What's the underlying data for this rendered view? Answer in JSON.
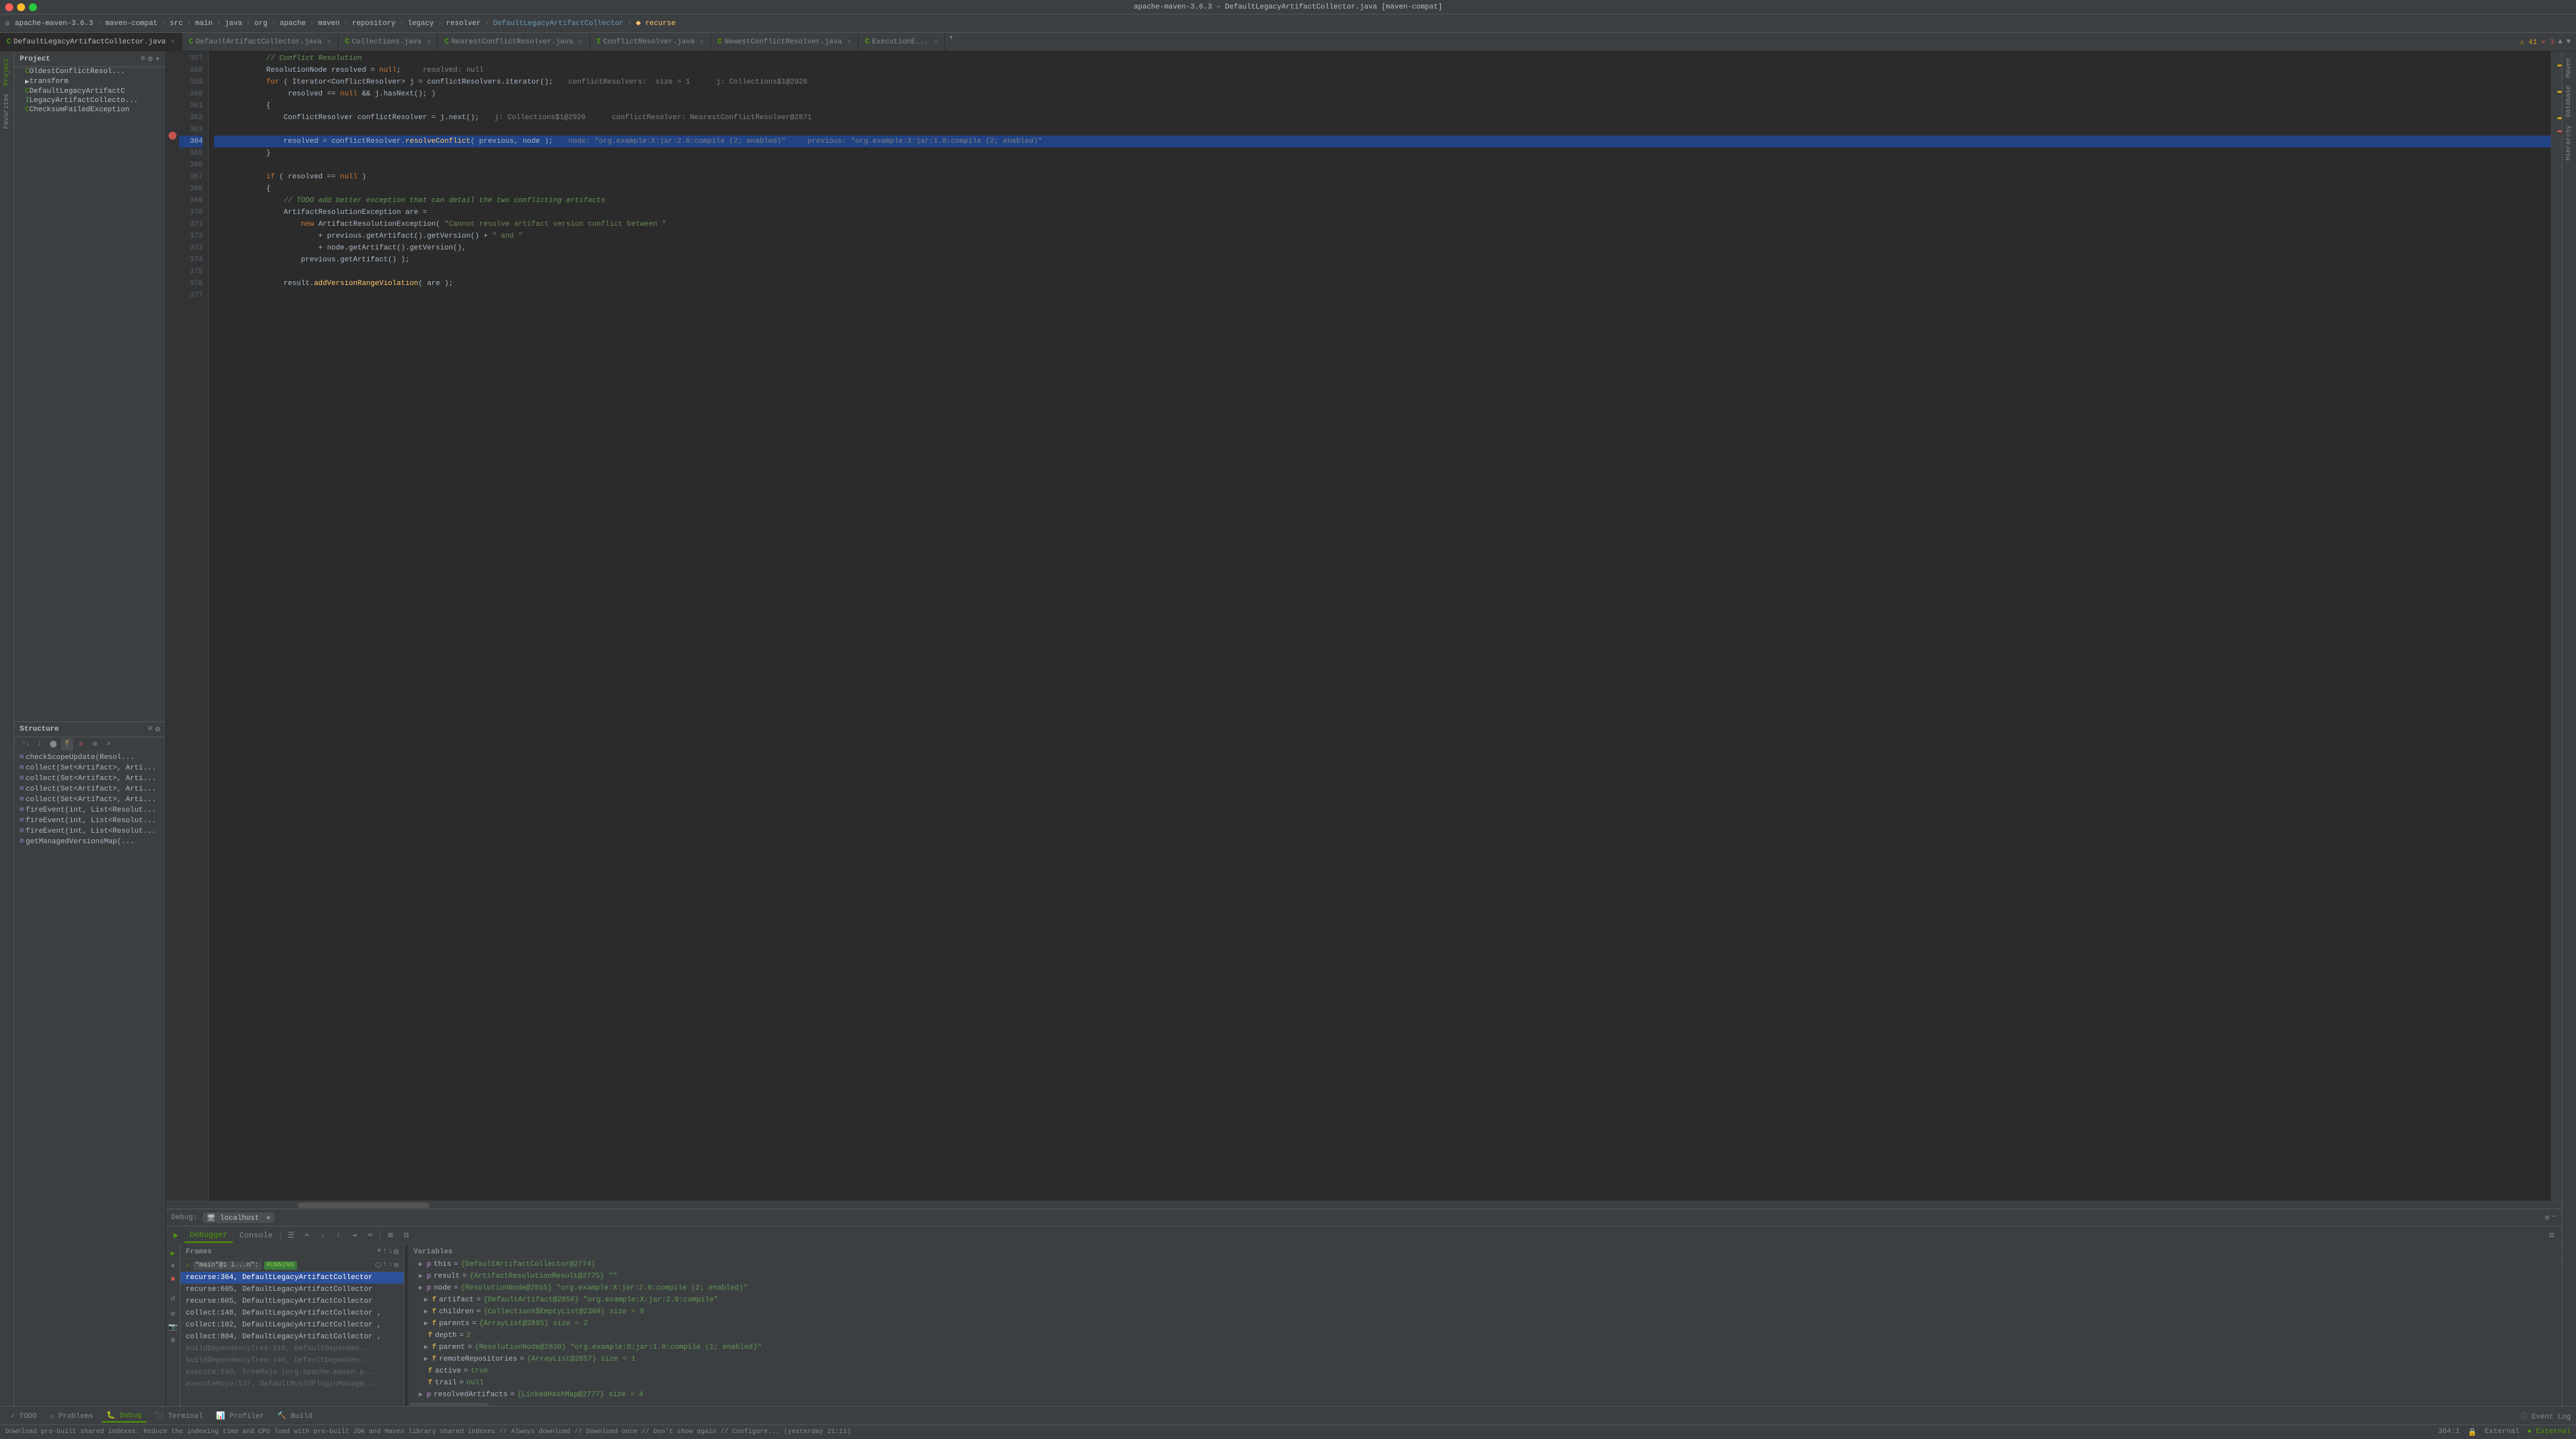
{
  "window": {
    "title": "apache-maven-3.6.3 – DefaultLegacyArtifactCollector.java [maven-compat]",
    "traffic_lights": [
      "red",
      "yellow",
      "green"
    ]
  },
  "breadcrumb": {
    "items": [
      "apache-maven-3.6.3",
      "maven-compat",
      "src",
      "main",
      "java",
      "org",
      "apache",
      "maven",
      "repository",
      "legacy",
      "resolver",
      "DefaultLegacyArtifactCollector",
      "recurse"
    ]
  },
  "tabs": [
    {
      "label": "DefaultLegacyArtifactCollector.java",
      "icon": "C",
      "active": true
    },
    {
      "label": "DefaultArtifactCollector.java",
      "icon": "C",
      "active": false
    },
    {
      "label": "Collections.java",
      "icon": "C",
      "active": false
    },
    {
      "label": "NearestConflictResolver.java",
      "icon": "C",
      "active": false
    },
    {
      "label": "ConflictResolver.java",
      "icon": "I",
      "active": false
    },
    {
      "label": "NewestConflictResolver.java",
      "icon": "C",
      "active": false
    },
    {
      "label": "ExecutionE...",
      "icon": "C",
      "active": false
    }
  ],
  "project_panel": {
    "title": "Project",
    "items": [
      {
        "name": "OldestConflictResol...",
        "icon": "C",
        "indent": 1
      },
      {
        "name": "transform",
        "icon": "folder",
        "indent": 1
      },
      {
        "name": "DefaultLegacyArtifactC",
        "icon": "C",
        "indent": 1
      },
      {
        "name": "LegacyArtifactCollecto...",
        "icon": "I",
        "indent": 1
      },
      {
        "name": "ChecksumFailedException",
        "icon": "C",
        "indent": 1
      }
    ]
  },
  "structure_panel": {
    "title": "Structure",
    "items": [
      {
        "name": "checkScopeUpdate(Resol...",
        "type": "m",
        "indent": 0
      },
      {
        "name": "collect(Set<Artifact>, Arti...",
        "type": "m",
        "indent": 0
      },
      {
        "name": "collect(Set<Artifact>, Arti...",
        "type": "m",
        "indent": 0
      },
      {
        "name": "collect(Set<Artifact>, Arti...",
        "type": "m",
        "indent": 0
      },
      {
        "name": "collect(Set<Artifact>, Arti...",
        "type": "m",
        "indent": 0
      },
      {
        "name": "fireEvent(int, List<Resolut...",
        "type": "m",
        "indent": 0
      },
      {
        "name": "fireEvent(int, List<Resolut...",
        "type": "m",
        "indent": 0
      },
      {
        "name": "fireEvent(int, List<Resolut...",
        "type": "m",
        "indent": 0
      },
      {
        "name": "getManagedVersionsMap(...",
        "type": "m",
        "indent": 0
      }
    ]
  },
  "code": {
    "lines": [
      {
        "num": 357,
        "text": "            // Conflict Resolution",
        "class": "cm"
      },
      {
        "num": 358,
        "text": "            ResolutionNode resolved = null;  resolved: null",
        "classes": ""
      },
      {
        "num": 359,
        "text": "            for ( Iterator<ConflictResolver> j = conflictResolvers.iterator();   conflictResolvers:  size = 1      j: Collections$1@2926",
        "classes": ""
      },
      {
        "num": 360,
        "text": "                 resolved == null && j.hasNext(); )",
        "classes": ""
      },
      {
        "num": 361,
        "text": "            {",
        "classes": ""
      },
      {
        "num": 362,
        "text": "                ConflictResolver conflictResolver = j.next();   j: Collections$1@2926      conflictResolver: NearestConflictResolver@2871",
        "classes": ""
      },
      {
        "num": 363,
        "text": "",
        "classes": ""
      },
      {
        "num": 364,
        "text": "                resolved = conflictResolver.resolveConflict( previous, node );   node: \"org.example:X:jar:2.0:compile (2; enabled)\"     previous: \"org.example:X:jar:1.0:compile (2; enabled)\"",
        "classes": "highlighted"
      },
      {
        "num": 365,
        "text": "            }",
        "classes": ""
      },
      {
        "num": 366,
        "text": "",
        "classes": ""
      },
      {
        "num": 367,
        "text": "            if ( resolved == null )",
        "classes": ""
      },
      {
        "num": 368,
        "text": "            {",
        "classes": ""
      },
      {
        "num": 369,
        "text": "                // TODO add better exception that can detail the two conflicting artifacts",
        "class": "cm"
      },
      {
        "num": 370,
        "text": "                ArtifactResolutionException are =",
        "classes": ""
      },
      {
        "num": 371,
        "text": "                    new ArtifactResolutionException( \"Cannot resolve artifact version conflict between \"",
        "classes": ""
      },
      {
        "num": 372,
        "text": "                        + previous.getArtifact().getVersion() + \" and \"",
        "classes": ""
      },
      {
        "num": 373,
        "text": "                        + node.getArtifact().getVersion(),",
        "classes": ""
      },
      {
        "num": 374,
        "text": "                    previous.getArtifact() );",
        "classes": ""
      },
      {
        "num": 375,
        "text": "",
        "classes": ""
      },
      {
        "num": 376,
        "text": "                result.addVersionRangeViolation( are );",
        "classes": ""
      },
      {
        "num": 377,
        "text": "",
        "classes": ""
      }
    ]
  },
  "debug": {
    "label": "Debug:",
    "server": "localhost",
    "tabs": [
      "Debugger",
      "Console"
    ],
    "active_tab": "Debugger",
    "frames_header": "Frames",
    "variables_header": "Variables",
    "frames": [
      {
        "text": "\"main\"@1 i...n\": RUNNING",
        "type": "thread",
        "selected": false
      },
      {
        "text": "recurse:364, DefaultLegacyArtifactCollector",
        "selected": true
      },
      {
        "text": "recurse:605, DefaultLegacyArtifactCollector",
        "selected": false
      },
      {
        "text": "recurse:605, DefaultLegacyArtifactCollector",
        "selected": false
      },
      {
        "text": "collect:148, DefaultLegacyArtifactCollector ,",
        "selected": false
      },
      {
        "text": "collect:102, DefaultLegacyArtifactCollector ,",
        "selected": false
      },
      {
        "text": "collect:804, DefaultLegacyArtifactCollector ,",
        "selected": false
      },
      {
        "text": "buildDependencyTree:118, DefaultDependen...",
        "selected": false,
        "gray": true
      },
      {
        "text": "buildDependencyTree:146, DefaultDependen...",
        "selected": false,
        "gray": true
      },
      {
        "text": "execute:246, TreeMojo (org.apache.maven.p...",
        "selected": false,
        "gray": true
      },
      {
        "text": "executeMojo:137, DefaultBuildPluginManage...",
        "selected": false,
        "gray": true
      }
    ],
    "variables": [
      {
        "indent": 0,
        "expand": "▶",
        "type": "p",
        "name": "this",
        "eq": "=",
        "val": "{DefaultArtifactCollector@2774}"
      },
      {
        "indent": 0,
        "expand": "▶",
        "type": "p",
        "name": "result",
        "eq": "=",
        "val": "{ArtifactResolutionResult@2775} \"\""
      },
      {
        "indent": 0,
        "expand": "▶",
        "type": "p",
        "name": "node",
        "eq": "=",
        "val": "{ResolutionNode@2855} \"org.example:X:jar:2.0:compile (2; enabled)\""
      },
      {
        "indent": 1,
        "expand": "▶",
        "type": "f",
        "name": "artifact",
        "eq": "=",
        "val": "{DefaultArtifact@2856} \"org.example:X:jar:2.0:compile\""
      },
      {
        "indent": 1,
        "expand": "▶",
        "type": "f",
        "name": "children",
        "eq": "=",
        "val": "{Collections$EmptyList@2309} size = 0"
      },
      {
        "indent": 1,
        "expand": "▶",
        "type": "f",
        "name": "parents",
        "eq": "=",
        "val": "{ArrayList@2895}  size = 2"
      },
      {
        "indent": 1,
        "expand": " ",
        "type": "f",
        "name": "depth",
        "eq": "=",
        "val": "2"
      },
      {
        "indent": 1,
        "expand": "▶",
        "type": "f",
        "name": "parent",
        "eq": "=",
        "val": "{ResolutionNode@2838} \"org.example:D:jar:1.0:compile (1; enabled)\""
      },
      {
        "indent": 1,
        "expand": "▶",
        "type": "f",
        "name": "remoteRepositories",
        "eq": "=",
        "val": "{ArrayList@2857}  size = 1"
      },
      {
        "indent": 1,
        "expand": " ",
        "type": "f",
        "name": "active",
        "eq": "=",
        "val": "true"
      },
      {
        "indent": 1,
        "expand": " ",
        "type": "f",
        "name": "trail",
        "eq": "=",
        "val": "null"
      },
      {
        "indent": 0,
        "expand": "▶",
        "type": "p",
        "name": "resolvedArtifacts",
        "eq": "=",
        "val": "{LinkedHashMap@2777}  size = 4"
      }
    ]
  },
  "bottom_tabs": [
    {
      "label": "TODO",
      "active": false
    },
    {
      "label": "Problems",
      "active": false
    },
    {
      "label": "Debug",
      "active": true
    },
    {
      "label": "Terminal",
      "active": false
    },
    {
      "label": "Profiler",
      "active": false
    },
    {
      "label": "Build",
      "active": false
    }
  ],
  "status_bar": {
    "message": "Download pre-built shared indexes: Reduce the indexing time and CPU load with pre-built JDK and Maven library shared indexes // Always download // Download once // Don't show again // Configure... (yesterday 21:11)",
    "position": "364:1",
    "lf_indicator": "External"
  },
  "right_tabs": [
    "Maven",
    "Hierarchy"
  ],
  "left_tabs": [
    "Project",
    "Favorites"
  ],
  "debug_side_buttons": [
    "resume",
    "pause",
    "stop",
    "restart",
    "settings",
    "more"
  ],
  "warnings": {
    "count": 41,
    "errors": 3
  }
}
